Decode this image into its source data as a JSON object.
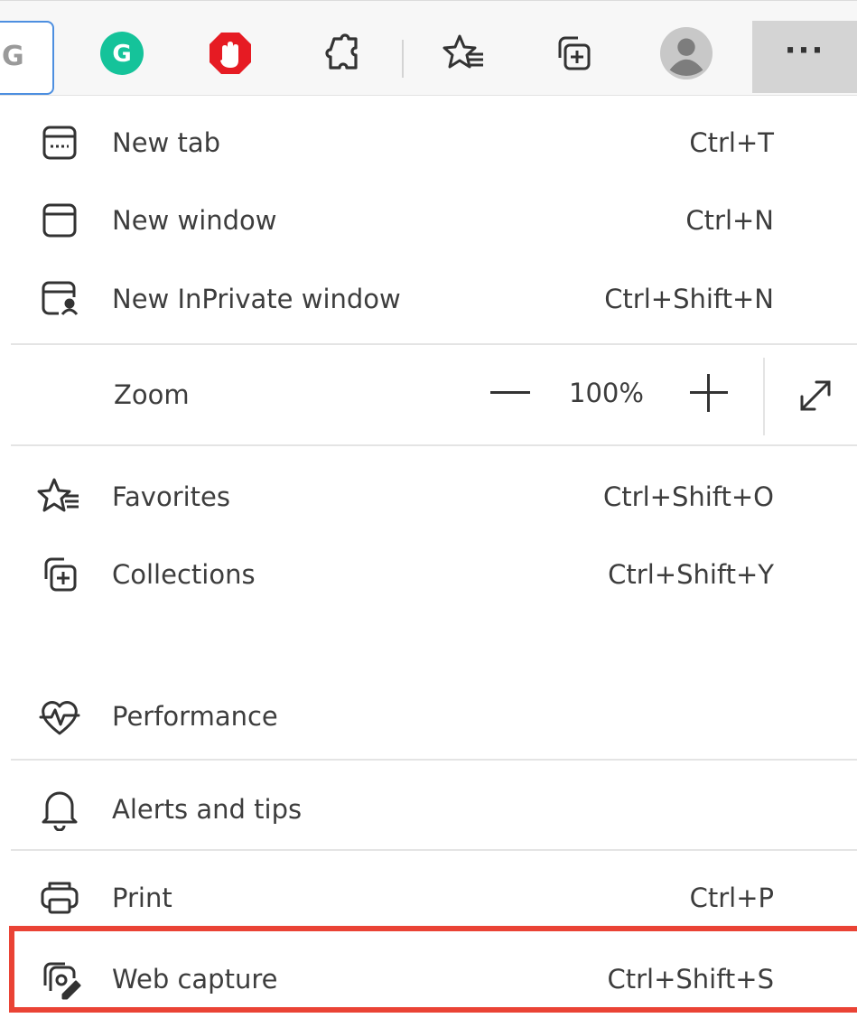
{
  "toolbar": {
    "address_partial_glyph": "G",
    "icons": [
      "grammarly-icon",
      "opera-adblock-icon",
      "extensions-icon",
      "favorites-icon",
      "collections-icon",
      "profile-icon",
      "more-icon"
    ],
    "more_label": "···"
  },
  "menu": {
    "new_tab": {
      "label": "New tab",
      "shortcut": "Ctrl+T"
    },
    "new_window": {
      "label": "New window",
      "shortcut": "Ctrl+N"
    },
    "new_inprivate": {
      "label": "New InPrivate window",
      "shortcut": "Ctrl+Shift+N"
    },
    "zoom": {
      "label": "Zoom",
      "value": "100%"
    },
    "favorites": {
      "label": "Favorites",
      "shortcut": "Ctrl+Shift+O"
    },
    "collections": {
      "label": "Collections",
      "shortcut": "Ctrl+Shift+Y"
    },
    "performance": {
      "label": "Performance"
    },
    "alerts": {
      "label": "Alerts and tips"
    },
    "print": {
      "label": "Print",
      "shortcut": "Ctrl+P"
    },
    "web_capture": {
      "label": "Web capture",
      "shortcut": "Ctrl+Shift+S"
    }
  },
  "colors": {
    "highlight": "#ea4335",
    "grammarly": "#15c39a",
    "opera": "#e61b23",
    "more_bg": "#d4d4d4"
  }
}
